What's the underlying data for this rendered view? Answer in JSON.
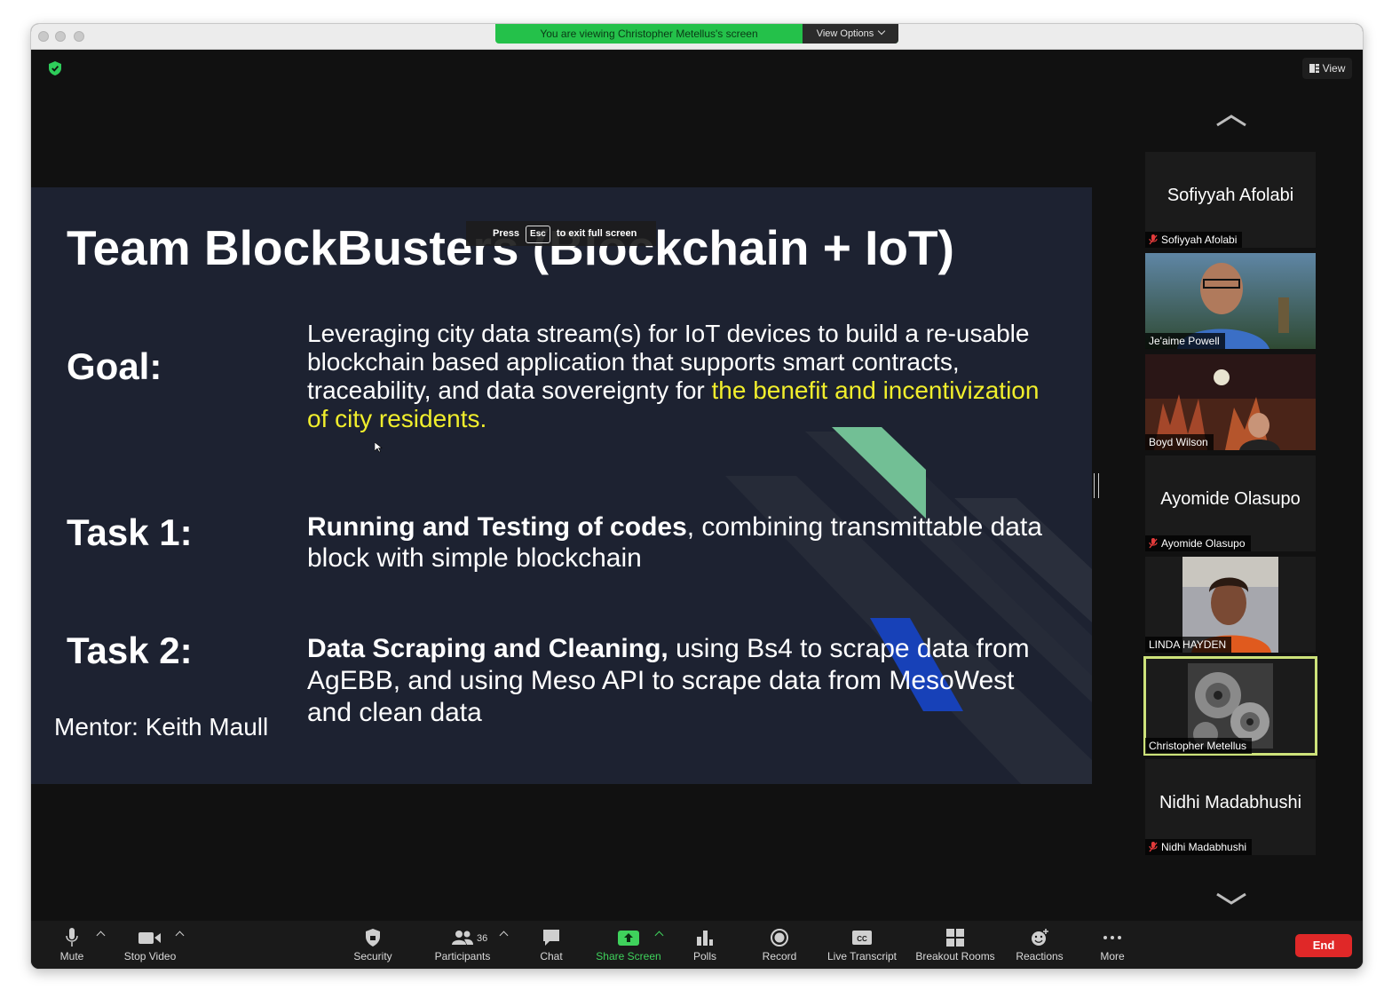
{
  "banner": {
    "viewing_text": "You are viewing Christopher Metellus's screen",
    "view_options_label": "View Options"
  },
  "top_right": {
    "view_label": "View"
  },
  "slide": {
    "title": "Team BlockBusters (Blockchain + IoT)",
    "esc_toast": {
      "press": "Press",
      "key": "Esc",
      "suffix": "to exit full screen"
    },
    "goal_label": "Goal:",
    "goal_text_plain": "Leveraging city data stream(s) for IoT devices to build a re-usable blockchain based application that supports smart contracts, traceability, and data sovereignty for ",
    "goal_text_highlight": "the benefit and incentivization of city residents.",
    "task1_label": "Task 1:",
    "task1_bold": "Running and Testing of codes",
    "task1_rest": ", combining transmittable data block with simple blockchain",
    "task2_label": "Task 2:",
    "task2_bold": "Data Scraping and Cleaning,",
    "task2_rest": " using Bs4 to scrape data from AgEBB, and using Meso API to scrape data from MesoWest and clean data",
    "mentor": "Mentor: Keith Maull",
    "highlight_color": "#f1ee2c"
  },
  "participants_panel": [
    {
      "display_name": "Sofiyyah Afolabi",
      "label": "Sofiyyah Afolabi",
      "muted": true,
      "video": false
    },
    {
      "label": "Je'aime Powell",
      "muted": false,
      "video": true
    },
    {
      "label": "Boyd Wilson",
      "muted": false,
      "video": true
    },
    {
      "display_name": "Ayomide Olasupo",
      "label": "Ayomide Olasupo",
      "muted": true,
      "video": false
    },
    {
      "label": "LINDA HAYDEN",
      "muted": false,
      "video": true
    },
    {
      "label": "Christopher Metellus",
      "muted": false,
      "video": true,
      "active_speaker": true
    },
    {
      "display_name": "Nidhi Madabhushi",
      "label": "Nidhi Madabhushi",
      "muted": true,
      "video": false
    }
  ],
  "toolbar": {
    "mute": "Mute",
    "stop_video": "Stop Video",
    "security": "Security",
    "participants": "Participants",
    "participants_count": "36",
    "chat": "Chat",
    "share_screen": "Share Screen",
    "polls": "Polls",
    "record": "Record",
    "live_transcript": "Live Transcript",
    "breakout_rooms": "Breakout Rooms",
    "reactions": "Reactions",
    "more": "More",
    "end": "End"
  },
  "colors": {
    "share_green": "#24c14a",
    "end_red": "#e02828",
    "active_speaker_border": "#cde27a"
  }
}
